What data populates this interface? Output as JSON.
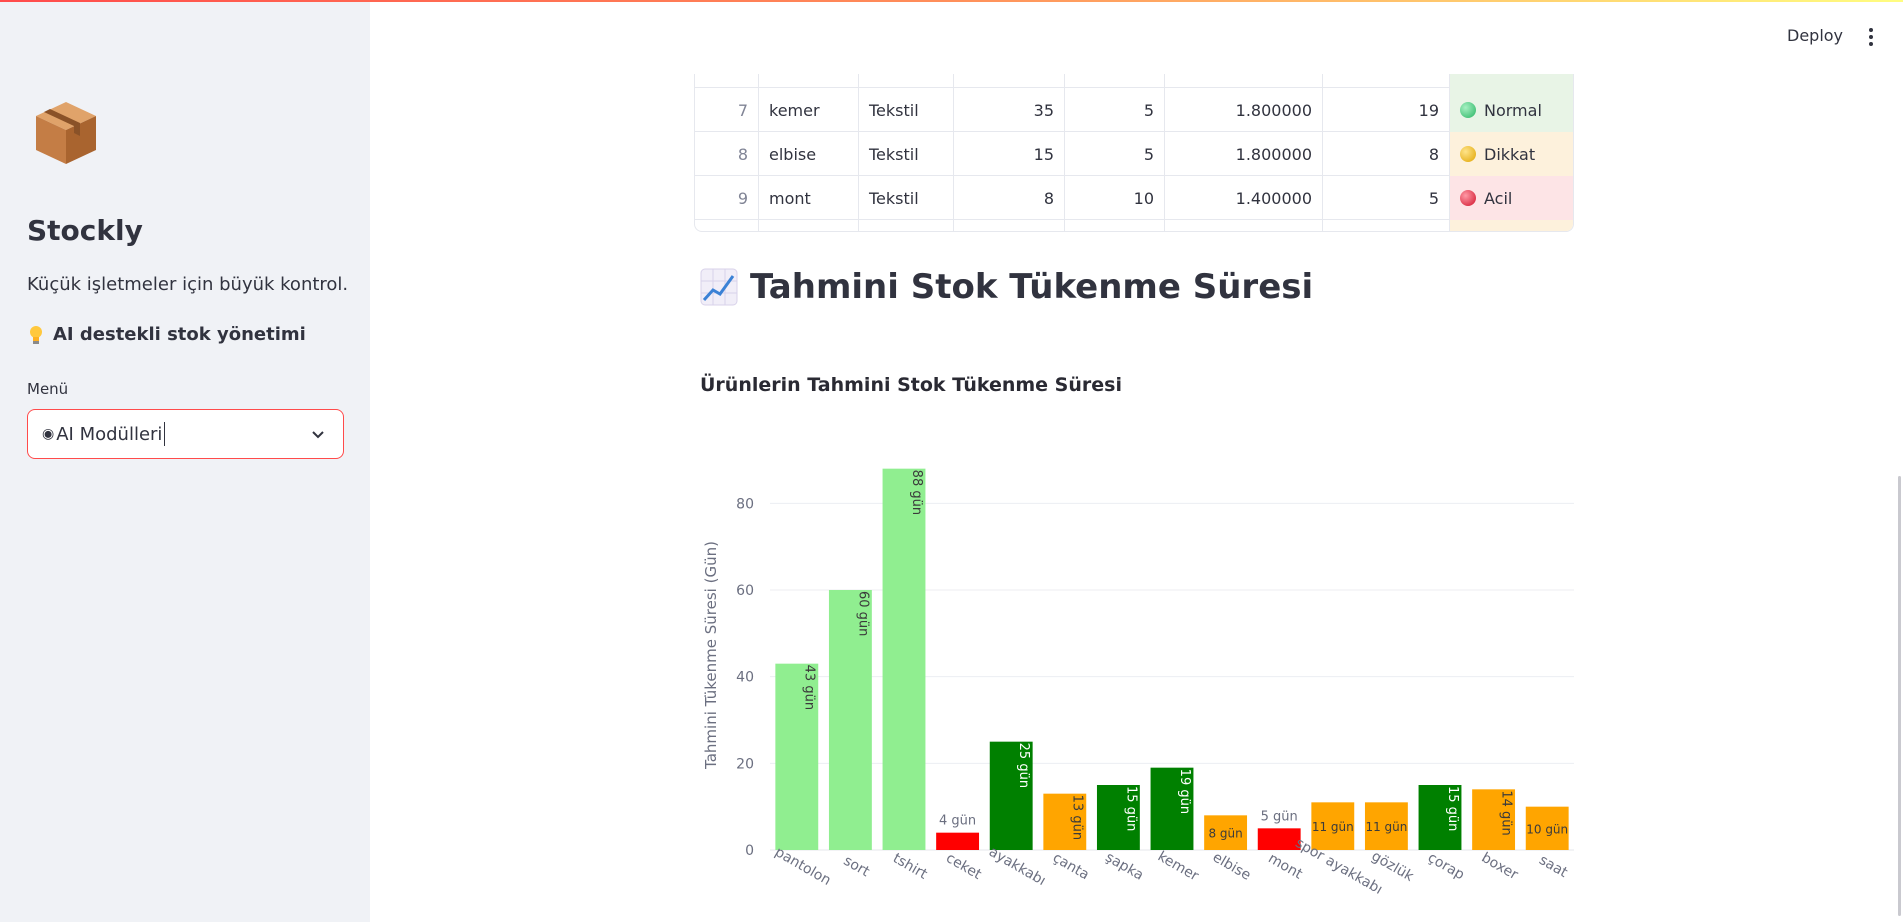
{
  "sidebar": {
    "title": "Stockly",
    "tagline": "Küçük işletmeler için büyük kontrol.",
    "ai_text": "AI destekli stok yönetimi",
    "menu_label": "Menü",
    "menu_value": "AI Modülleri"
  },
  "header": {
    "deploy_label": "Deploy"
  },
  "table": {
    "rows": [
      {
        "idx": "7",
        "name": "kemer",
        "cat": "Tekstil",
        "n1": "35",
        "n2": "5",
        "n3": "1.800000",
        "n4": "19",
        "status": "Normal",
        "level": "green"
      },
      {
        "idx": "8",
        "name": "elbise",
        "cat": "Tekstil",
        "n1": "15",
        "n2": "5",
        "n3": "1.800000",
        "n4": "8",
        "status": "Dikkat",
        "level": "yellow"
      },
      {
        "idx": "9",
        "name": "mont",
        "cat": "Tekstil",
        "n1": "8",
        "n2": "10",
        "n3": "1.400000",
        "n4": "5",
        "status": "Acil",
        "level": "red"
      }
    ]
  },
  "section": {
    "title": "Tahmini Stok Tükenme Süresi"
  },
  "chart_title": "Ürünlerin Tahmini Stok Tükenme Süresi",
  "colors": {
    "accent": "#ff4b4b",
    "lightgreen": "#90ee90",
    "green": "#008000",
    "orange": "#ffa500",
    "red": "#ff0000"
  },
  "chart_data": {
    "type": "bar",
    "title": "Ürünlerin Tahmini Stok Tükenme Süresi",
    "ylabel": "Tahmini Tükenme Süresi (Gün)",
    "xlabel": "",
    "ylim": [
      0,
      90
    ],
    "yticks": [
      0,
      20,
      40,
      60,
      80
    ],
    "grid": true,
    "categories": [
      "pantolon",
      "sort",
      "tshirt",
      "ceket",
      "ayakkabı",
      "çanta",
      "şapka",
      "kemer",
      "elbise",
      "mont",
      "spor ayakkabı",
      "gözlük",
      "çorap",
      "boxer",
      "saat"
    ],
    "values": [
      43,
      60,
      88,
      4,
      25,
      13,
      15,
      19,
      8,
      5,
      11,
      11,
      15,
      14,
      10
    ],
    "labels": [
      "43 gün",
      "60 gün",
      "88 gün",
      "4 gün",
      "25 gün",
      "13 gün",
      "15 gün",
      "19 gün",
      "8 gün",
      "5 gün",
      "11 gün",
      "11 gün",
      "15 gün",
      "14 gün",
      "10 gün"
    ],
    "bar_colors": [
      "#90ee90",
      "#90ee90",
      "#90ee90",
      "#ff0000",
      "#008000",
      "#ffa500",
      "#008000",
      "#008000",
      "#ffa500",
      "#ff0000",
      "#ffa500",
      "#ffa500",
      "#008000",
      "#ffa500",
      "#ffa500"
    ]
  }
}
